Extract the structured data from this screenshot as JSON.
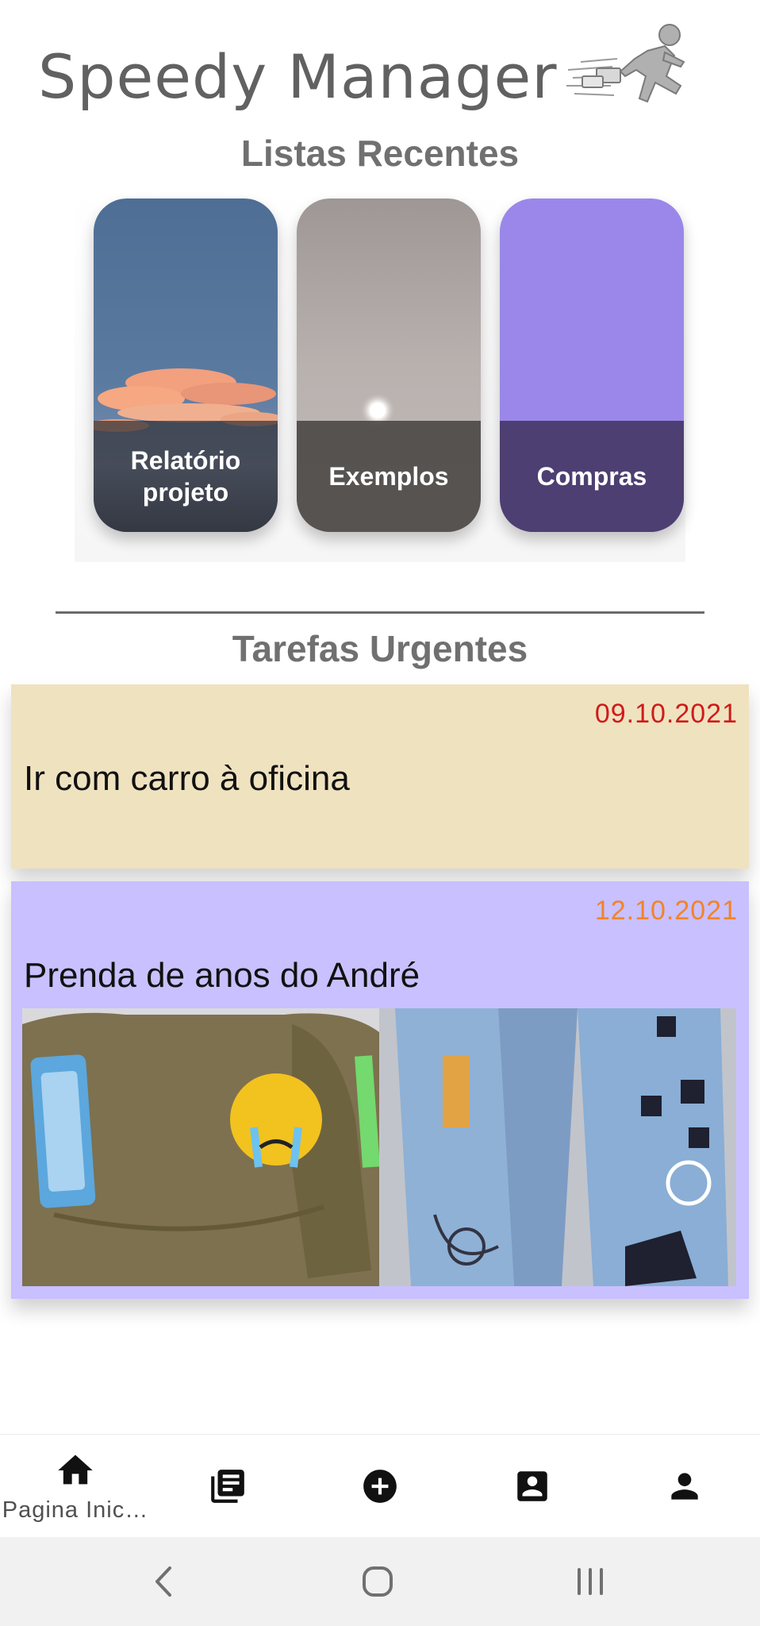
{
  "app": {
    "title": "Speedy Manager",
    "logo_icon": "running-man-logo-icon"
  },
  "recent_lists": {
    "heading": "Listas Recentes",
    "cards": [
      {
        "label": "Relatório\nprojeto",
        "background": "sunset-sky-photo",
        "overlay_color": "#3a3a3a"
      },
      {
        "label": "Exemplos",
        "background": "grey-moon-photo",
        "overlay_color": "#4e4a48"
      },
      {
        "label": "Compras",
        "background": "#9b87ea",
        "overlay_color": "#4d3f72"
      }
    ]
  },
  "urgent_tasks": {
    "heading": "Tarefas Urgentes",
    "items": [
      {
        "date": "09.10.2021",
        "date_color": "#d01b1b",
        "title": "Ir com carro à oficina",
        "background": "#efe2bf"
      },
      {
        "date": "12.10.2021",
        "date_color": "#f0842a",
        "title": "Prenda de anos do André",
        "background": "#c9c0ff",
        "image": "sweatshirt-and-jeans-photo"
      }
    ]
  },
  "bottom_nav": {
    "items": [
      {
        "icon": "home-icon",
        "label": "Pagina Inic…",
        "active": true
      },
      {
        "icon": "lists-icon"
      },
      {
        "icon": "add-circle-icon"
      },
      {
        "icon": "contact-card-icon"
      },
      {
        "icon": "person-icon"
      }
    ]
  },
  "system_nav": {
    "buttons": [
      "back-icon",
      "home-circle-icon",
      "recents-icon"
    ]
  }
}
